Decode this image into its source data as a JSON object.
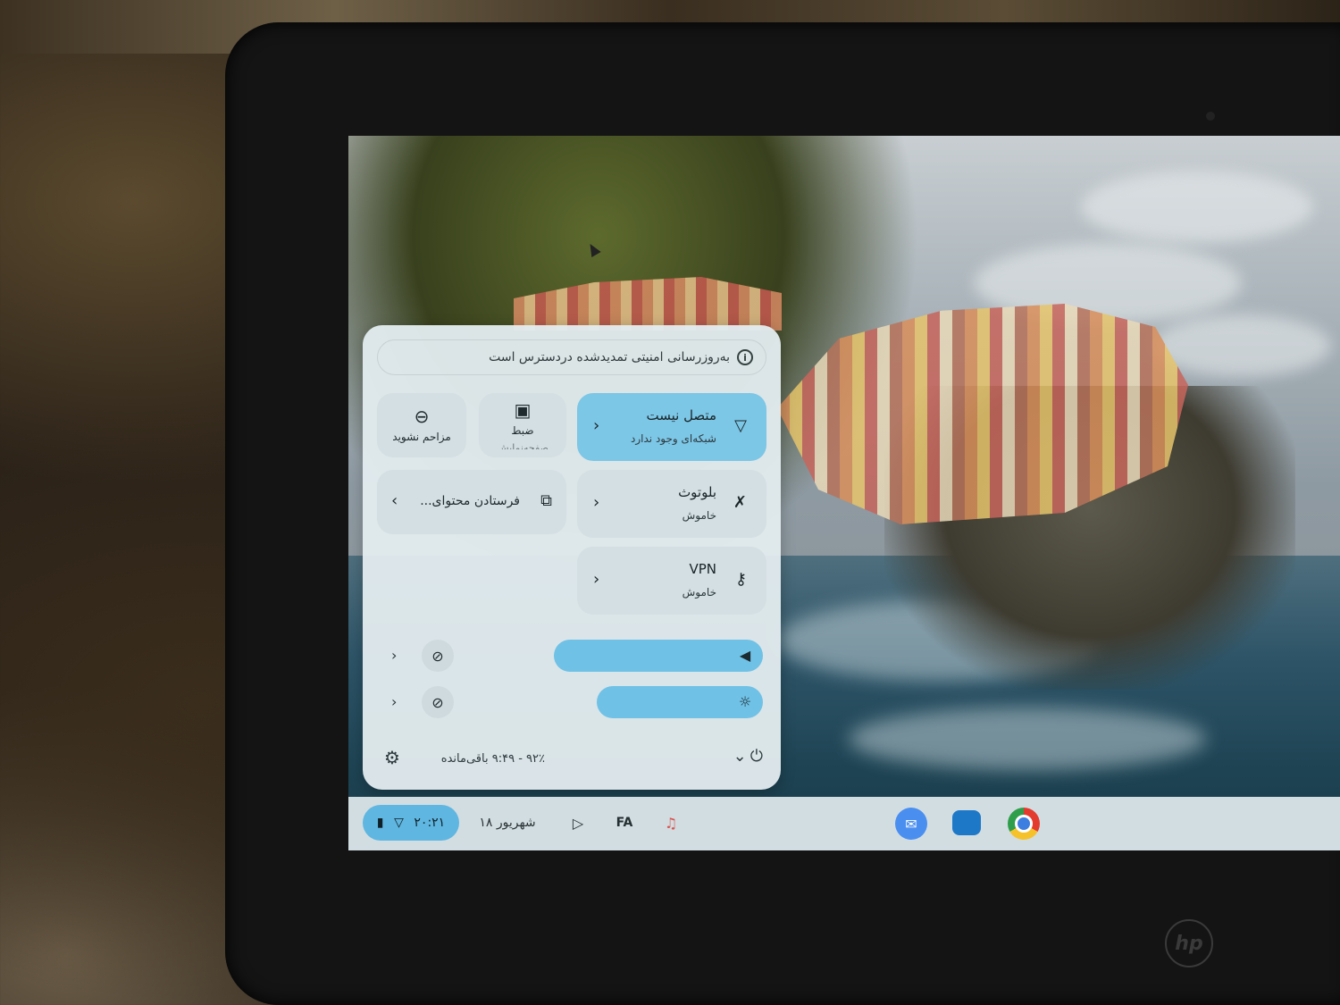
{
  "quick_settings": {
    "notice": "به‌روزرسانی امنیتی تمدیدشده دردسترس است",
    "network": {
      "title": "متصل نیست",
      "subtitle": "شبکه‌ای وجود ندارد"
    },
    "bluetooth": {
      "title": "بلوتوث",
      "subtitle": "خاموش"
    },
    "vpn": {
      "title": "VPN",
      "subtitle": "خاموش"
    },
    "screen_record": {
      "label": "ضبط",
      "label2": "صفحه‌نمایش"
    },
    "do_not_disturb": {
      "label": "مزاحم نشوید"
    },
    "cast": {
      "label": "فرستادن محتوای..."
    },
    "volume_level": 0.78,
    "brightness_level": 0.62,
    "battery_status": "۹۲٪ - ۹:۴۹ باقی‌مانده"
  },
  "shelf": {
    "time": "۲۰:۲۱",
    "date": "۱۸ شهریور",
    "input_method": "FA"
  },
  "device": {
    "brand": "hp"
  }
}
